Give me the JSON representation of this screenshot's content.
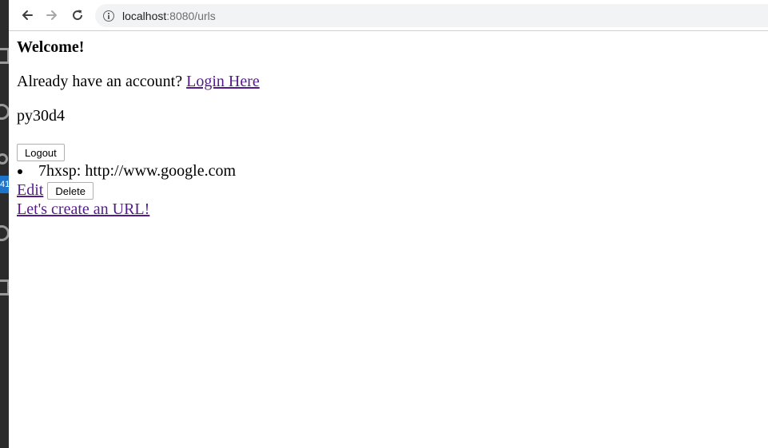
{
  "browser": {
    "url_host": "localhost",
    "url_rest": ":8080/urls"
  },
  "sidebar": {
    "badge": "41"
  },
  "page": {
    "welcome": "Welcome!",
    "already_text": "Already have an account? ",
    "login_link": "Login Here",
    "user_id": "py30d4",
    "logout_label": "Logout",
    "urls": [
      {
        "text": "7hxsp: http://www.google.com"
      }
    ],
    "edit_link": "Edit",
    "delete_label": "Delete",
    "create_link": "Let's create an URL!"
  }
}
